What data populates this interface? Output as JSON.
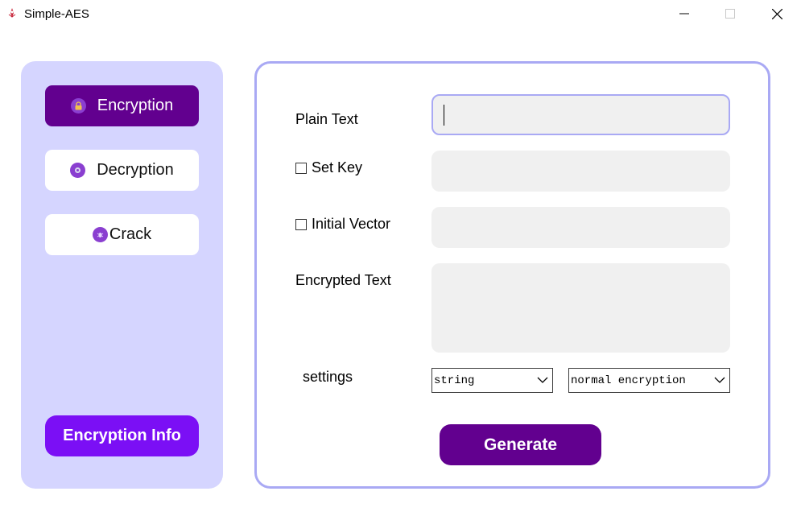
{
  "window": {
    "title": "Simple-AES"
  },
  "sidebar": {
    "items": [
      {
        "label": "Encryption",
        "icon": "lock-icon",
        "active": true
      },
      {
        "label": "Decryption",
        "icon": "unlock-icon",
        "active": false
      },
      {
        "label": "Crack",
        "icon": "bug-icon",
        "active": false
      }
    ],
    "info_button": "Encryption Info"
  },
  "form": {
    "plain_text_label": "Plain Text",
    "plain_text_value": "",
    "set_key_label": "Set Key",
    "set_key_checked": false,
    "key_value": "",
    "iv_label": "Initial Vector",
    "iv_checked": false,
    "iv_value": "",
    "encrypted_label": "Encrypted Text",
    "encrypted_value": "",
    "settings_label": "settings",
    "format_select": "string",
    "mode_select": "normal encryption",
    "generate_button": "Generate"
  },
  "colors": {
    "sidebar_bg": "#d5d5ff",
    "active_nav": "#62008f",
    "info_button": "#7b0ff5",
    "panel_border": "#a9a9f4",
    "field_bg": "#f0f0f0"
  }
}
